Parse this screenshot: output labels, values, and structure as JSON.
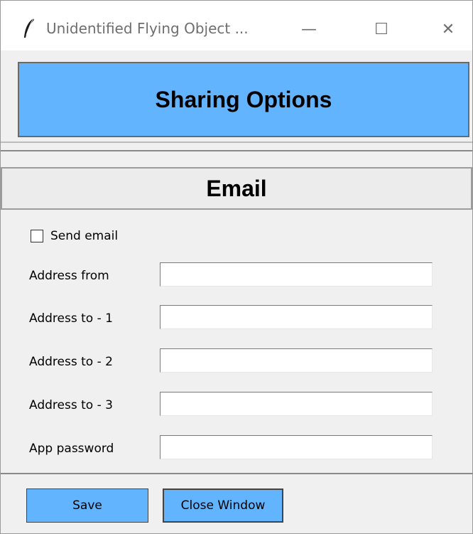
{
  "window": {
    "title": "Unidentified Flying Object ...",
    "icons": {
      "app": "feather-icon",
      "minimize": "minimize-icon",
      "maximize": "maximize-icon",
      "close": "close-icon"
    },
    "minimize_glyph": "—",
    "maximize_glyph": "☐",
    "close_glyph": "✕"
  },
  "header": {
    "title": "Sharing Options",
    "bg_color": "#63b4ff"
  },
  "email": {
    "section_title": "Email",
    "send_email_label": "Send email",
    "send_email_checked": false,
    "fields": [
      {
        "label": "Address from",
        "value": ""
      },
      {
        "label": "Address to - 1",
        "value": ""
      },
      {
        "label": "Address to - 2",
        "value": ""
      },
      {
        "label": "Address to - 3",
        "value": ""
      },
      {
        "label": "App password",
        "value": ""
      }
    ]
  },
  "footer": {
    "save_label": "Save",
    "close_label": "Close Window",
    "button_color": "#63b4ff"
  }
}
